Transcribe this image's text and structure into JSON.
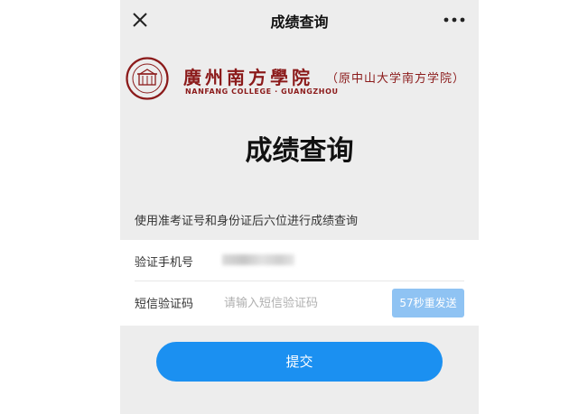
{
  "navbar": {
    "title": "成绩查询",
    "close_icon": "close-icon",
    "more_icon": "more-dots-icon"
  },
  "school": {
    "name_cn": "廣州南方學院",
    "name_alt": "（原中山大学南方学院）",
    "name_en": "NANFANG COLLEGE · GUANGZHOU",
    "seal_icon": "school-seal-logo",
    "brand_color": "#8b1a1a"
  },
  "page": {
    "heading": "成绩查询",
    "instruction": "使用准考证号和身份证后六位进行成绩查询"
  },
  "form": {
    "phone_label": "验证手机号",
    "code_label": "短信验证码",
    "code_placeholder": "请输入短信验证码",
    "resend_label": "57秒重发送",
    "submit_label": "提交"
  },
  "colors": {
    "accent": "#1b90f1",
    "resend_disabled": "#8fc3f3",
    "background": "#ededed"
  }
}
